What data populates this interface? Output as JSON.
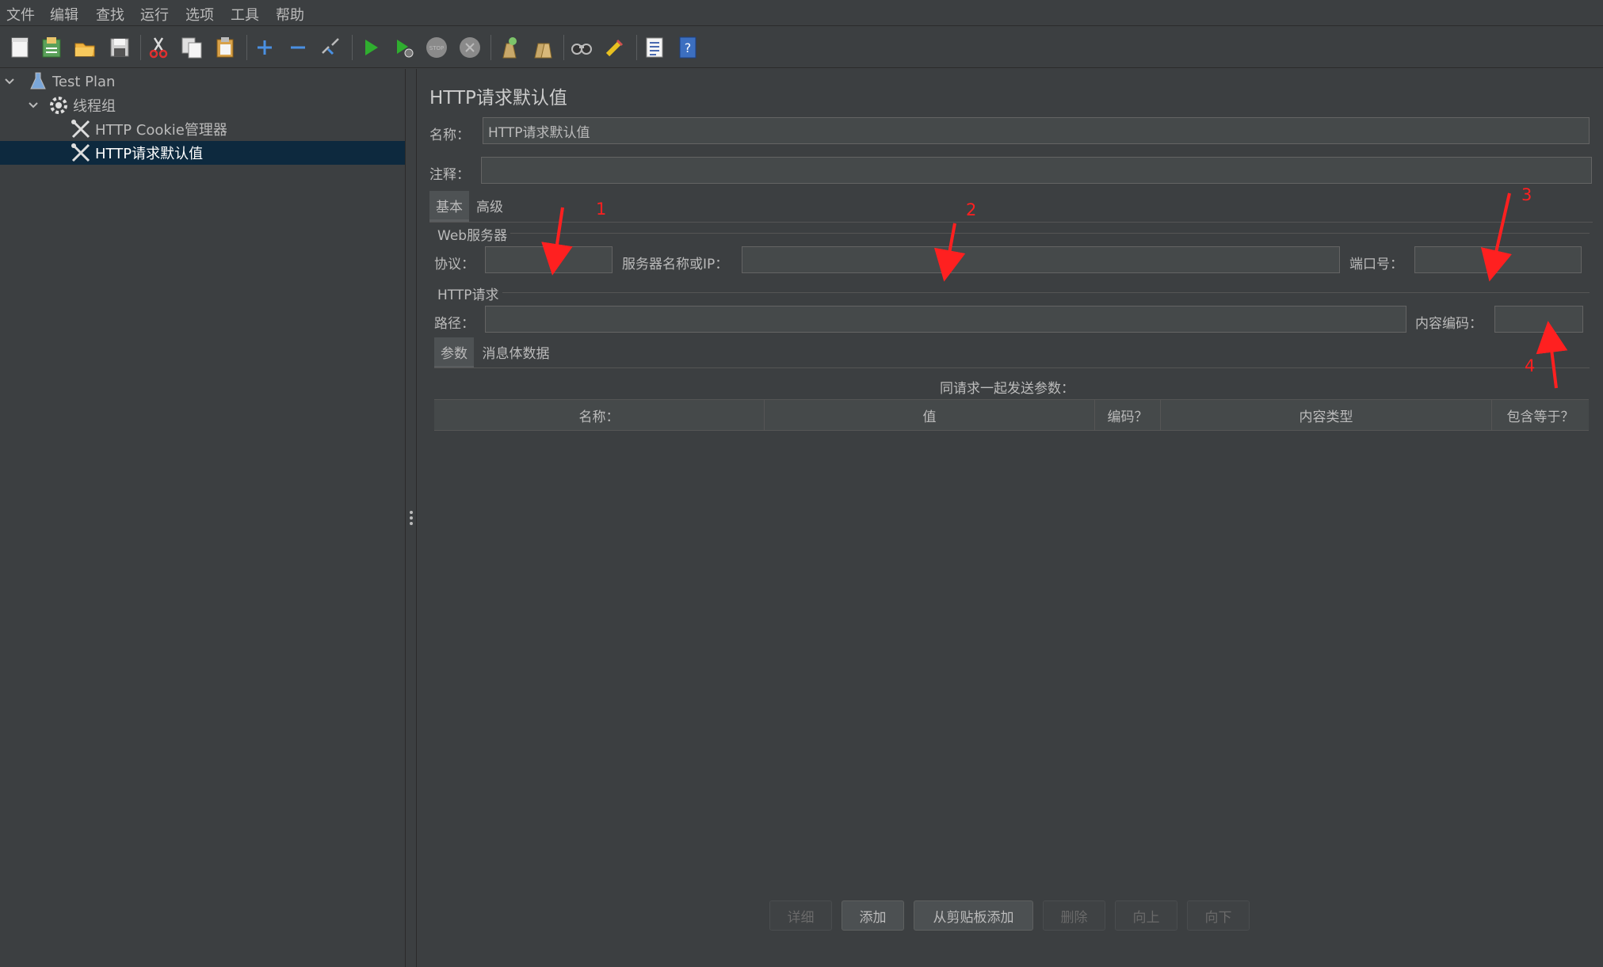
{
  "menu": [
    "文件",
    "编辑",
    "查找",
    "运行",
    "选项",
    "工具",
    "帮助"
  ],
  "toolbar_icons": [
    "new-icon",
    "templates-icon",
    "open-icon",
    "save-icon",
    "cut-icon",
    "copy-icon",
    "paste-icon",
    "expand-icon",
    "collapse-icon",
    "toggle-icon",
    "start-icon",
    "start-no-pause-icon",
    "stop-icon",
    "shutdown-icon",
    "clear-icon",
    "clear-all-icon",
    "search-icon",
    "reset-search-icon",
    "function-helper-icon",
    "help-icon"
  ],
  "tree": {
    "items": [
      {
        "label": "Test Plan",
        "icon": "flask-icon"
      },
      {
        "label": "线程组",
        "icon": "gear-icon"
      },
      {
        "label": "HTTP Cookie管理器",
        "icon": "tools-icon"
      },
      {
        "label": "HTTP请求默认值",
        "icon": "tools-icon"
      }
    ]
  },
  "panel": {
    "title": "HTTP请求默认值",
    "name_label": "名称：",
    "name_value": "HTTP请求默认值",
    "comment_label": "注释：",
    "comment_value": "",
    "tabs": [
      "基本",
      "高级"
    ],
    "web_server_title": "Web服务器",
    "protocol_label": "协议：",
    "server_label": "服务器名称或IP：",
    "port_label": "端口号：",
    "http_request_title": "HTTP请求",
    "path_label": "路径：",
    "encoding_label": "内容编码：",
    "subtabs": [
      "参数",
      "消息体数据"
    ],
    "params_caption": "同请求一起发送参数：",
    "columns": [
      "名称：",
      "值",
      "编码？",
      "内容类型",
      "包含等于？"
    ],
    "buttons": [
      {
        "label": "详细",
        "enabled": false
      },
      {
        "label": "添加",
        "enabled": true
      },
      {
        "label": "从剪贴板添加",
        "enabled": true
      },
      {
        "label": "删除",
        "enabled": false
      },
      {
        "label": "向上",
        "enabled": false
      },
      {
        "label": "向下",
        "enabled": false
      }
    ]
  },
  "annotations": [
    "1",
    "2",
    "3",
    "4"
  ],
  "colors": {
    "background": "#3c3f41",
    "selected": "#0d293e",
    "annotation": "#ff2020"
  }
}
